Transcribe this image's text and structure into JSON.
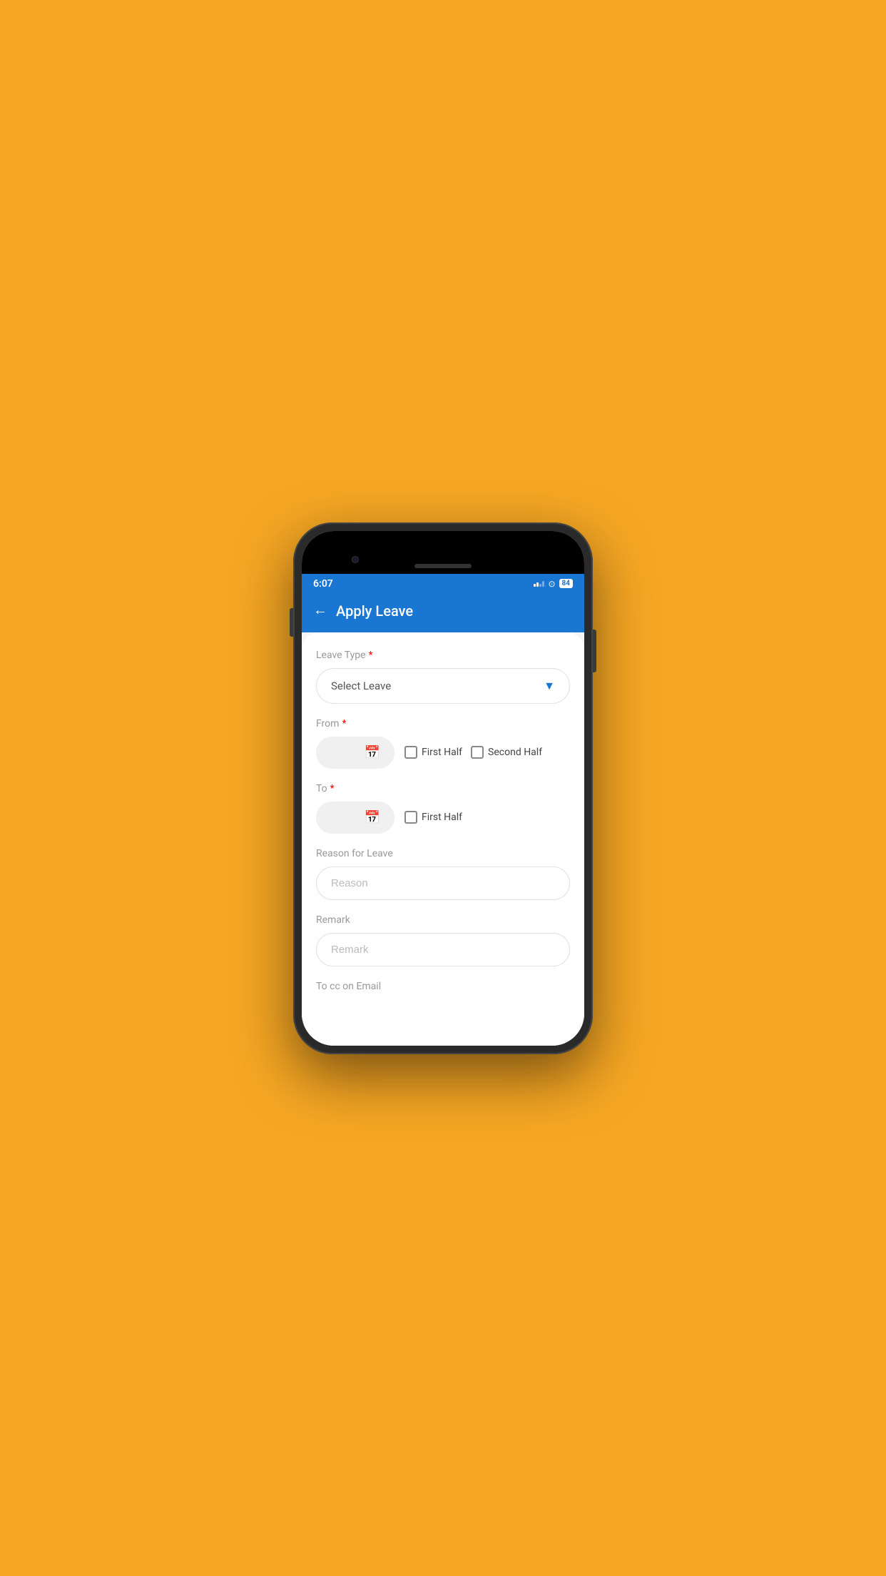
{
  "status": {
    "time": "6:07",
    "battery": "84"
  },
  "header": {
    "back_label": "←",
    "title": "Apply Leave"
  },
  "form": {
    "leave_type_label": "Leave Type",
    "leave_type_placeholder": "Select Leave",
    "from_label": "From",
    "from_first_half": "First Half",
    "from_second_half": "Second Half",
    "to_label": "To",
    "to_first_half": "First Half",
    "reason_label": "Reason for Leave",
    "reason_placeholder": "Reason",
    "remark_label": "Remark",
    "remark_placeholder": "Remark",
    "to_cc_label": "To cc on Email"
  }
}
